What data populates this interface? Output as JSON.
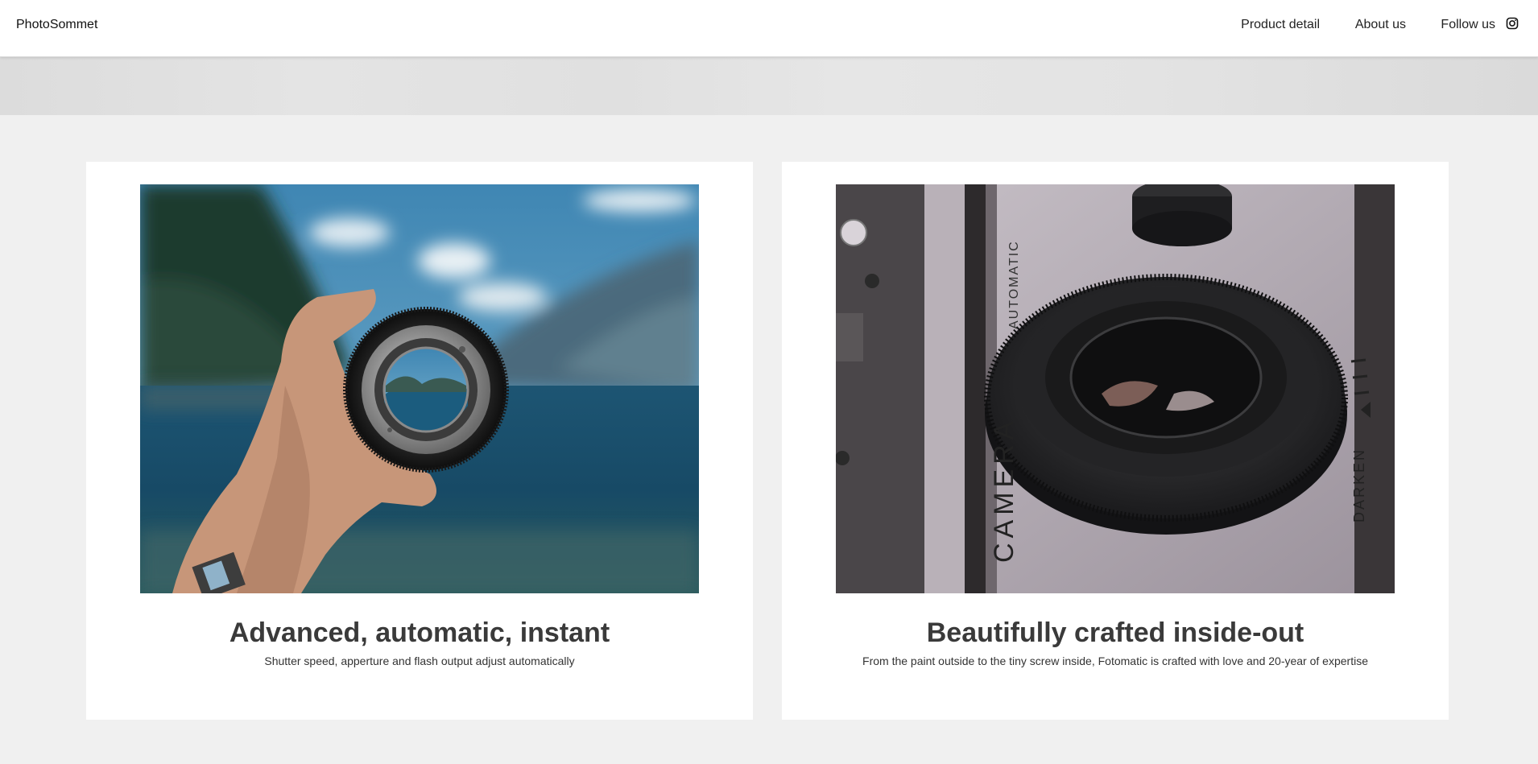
{
  "nav": {
    "brand": "PhotoSommet",
    "links": [
      "Product detail",
      "About us",
      "Follow us"
    ]
  },
  "features": [
    {
      "title": "Advanced, automatic, instant",
      "description": "Shutter speed, apperture and flash output adjust automatically",
      "image": "hand-holding-lens-photo"
    },
    {
      "title": "Beautifully crafted inside-out",
      "description": "From the paint outside to the tiny screw inside, Fotomatic is crafted with love and 20-year of expertise",
      "image": "vintage-camera-lens-photo"
    }
  ],
  "camera_labels": {
    "brand": "CAMERA",
    "dial": "DARKEN",
    "top": "AUTOMATIC"
  },
  "icons": {
    "follow": "instagram-icon"
  }
}
